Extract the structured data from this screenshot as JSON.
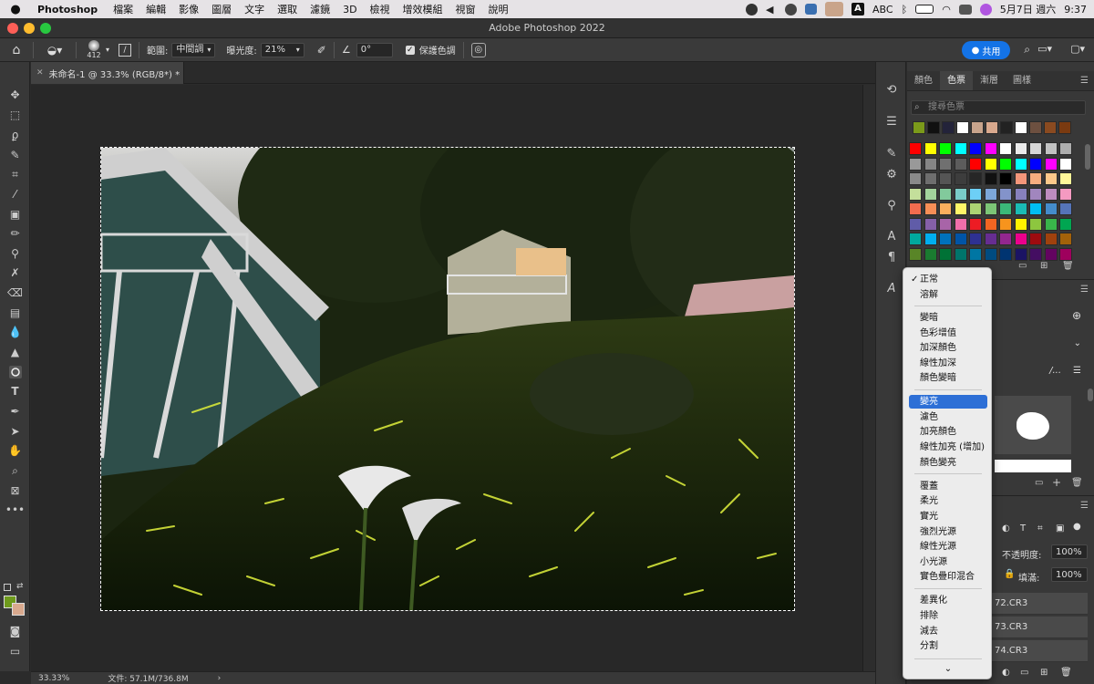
{
  "menubar": {
    "app": "Photoshop",
    "items": [
      "檔案",
      "編輯",
      "影像",
      "圖層",
      "文字",
      "選取",
      "濾鏡",
      "3D",
      "檢視",
      "增效模組",
      "視窗",
      "說明"
    ],
    "input_method": "ABC",
    "date": "5月7日 週六",
    "time": "9:37"
  },
  "window": {
    "title": "Adobe Photoshop 2022"
  },
  "options": {
    "brush_size": "412",
    "range_label": "範圍:",
    "range_value": "中間調",
    "exposure_label": "曝光度:",
    "exposure_value": "21%",
    "angle_value": "0°",
    "protect_tones_label": "保護色調",
    "share_label": "共用"
  },
  "document": {
    "tab_title": "未命名-1 @ 33.3% (RGB/8*) *"
  },
  "status": {
    "zoom": "33.33%",
    "file_info": "文件: 57.1M/736.8M"
  },
  "panels": {
    "tabs": [
      "顏色",
      "色票",
      "漸層",
      "圖樣"
    ],
    "active_tab": "色票",
    "search_placeholder": "搜尋色票",
    "layers": {
      "opacity_label": "不透明度:",
      "opacity_value": "100%",
      "fill_label": "填滿:",
      "fill_value": "100%",
      "items": [
        "72.CR3",
        "73.CR3",
        "74.CR3"
      ]
    }
  },
  "blend_menu": {
    "groups": [
      [
        "正常",
        "溶解"
      ],
      [
        "變暗",
        "色彩增值",
        "加深顏色",
        "線性加深",
        "顏色變暗"
      ],
      [
        "變亮",
        "濾色",
        "加亮顏色",
        "線性加亮 (增加)",
        "顏色變亮"
      ],
      [
        "覆蓋",
        "柔光",
        "實光",
        "強烈光源",
        "線性光源",
        "小光源",
        "實色疊印混合"
      ],
      [
        "差異化",
        "排除",
        "減去",
        "分割"
      ]
    ],
    "checked": "正常",
    "highlighted": "變亮",
    "check_mark": "✓"
  },
  "colors": {
    "foreground": "#6e9a1c",
    "background": "#d9a98e",
    "accent": "#1473e6",
    "recent_swatches": [
      "#7b9a1a",
      "#111111",
      "#23233a",
      "#ffffff",
      "#c8a48c",
      "#d9a98e",
      "#222222",
      "#ffffff",
      "#6d5040",
      "#8a4a20",
      "#7a3a10"
    ],
    "swatch_grid": [
      [
        "#ff0000",
        "#ffff00",
        "#00ff00",
        "#00ffff",
        "#0000ff",
        "#ff00ff",
        "#ffffff",
        "#ebebeb",
        "#d6d6d6",
        "#c2c2c2",
        "#adadad"
      ],
      [
        "#999999",
        "#858585",
        "#707070",
        "#5c5c5c",
        "#ff0000",
        "#ffff00",
        "#00ff00",
        "#00ffff",
        "#0000ff",
        "#ff00ff",
        "#ffffff"
      ],
      [
        "#8a8a8a",
        "#6e6e6e",
        "#555555",
        "#3d3d3d",
        "#262626",
        "#111111",
        "#000000",
        "#f4967a",
        "#f7ad7f",
        "#fcc88a",
        "#fff799"
      ],
      [
        "#c4df9b",
        "#a3d39c",
        "#82ca9c",
        "#7accc8",
        "#6dcff6",
        "#7da7d9",
        "#8393ca",
        "#8781bd",
        "#a186be",
        "#bd8cbf",
        "#f49ac1"
      ],
      [
        "#f26c4f",
        "#f68e56",
        "#fbaf5d",
        "#fff568",
        "#acd373",
        "#7cc576",
        "#3bb878",
        "#1abbb4",
        "#00bff3",
        "#448ccb",
        "#5574b9"
      ],
      [
        "#605ca8",
        "#8560a8",
        "#a864a8",
        "#f06eaa",
        "#ed1c24",
        "#f26522",
        "#f7941d",
        "#fff200",
        "#8dc63f",
        "#39b54a",
        "#00a651"
      ],
      [
        "#00a99d",
        "#00aeef",
        "#0072bc",
        "#0054a6",
        "#2e3192",
        "#662d91",
        "#92278f",
        "#ec008c",
        "#9e0b0f",
        "#a0410d",
        "#a3620a"
      ],
      [
        "#598527",
        "#1a7b30",
        "#007236",
        "#00746b",
        "#0076a3",
        "#004b80",
        "#003471",
        "#1b1464",
        "#440e62",
        "#630460",
        "#9e005d"
      ]
    ]
  }
}
